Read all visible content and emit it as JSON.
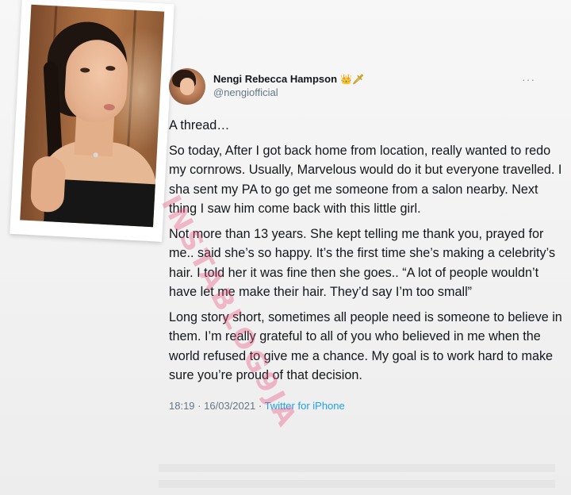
{
  "tweet": {
    "display_name": "Nengi Rebecca Hampson",
    "name_emojis": "👑🗡",
    "handle": "@nengiofficial",
    "more_icon": "more-icon",
    "paragraphs": [
      "A thread…",
      "So today, After I got back home from location, really wanted to redo my cornrows. Usually, Marvelous would do it but everyone travelled. I sha sent my PA to go get me someone from a salon nearby. Next thing I saw him come back with this little girl.",
      "Not more than 13 years. She kept telling me thank you, prayed for me.. said she’s so happy. It’s the first time she’s making a celebrity’s hair. I told her it was fine then she goes.. “A lot of people wouldn’t have let me make their hair. They’d say I’m too small”",
      "Long story short, sometimes all people need is someone to believe in them. I’m really grateful to all of you who believed in me when the world refused to give me a chance. My goal is to work hard to make sure you’re proud of that decision."
    ],
    "time": "18:19",
    "date": "16/03/2021",
    "separator": "·",
    "source": "Twitter for iPhone"
  },
  "watermark": "INSTABLOG9JA",
  "colors": {
    "text": "#14171a",
    "muted": "#657786",
    "link": "#1da1f2",
    "watermark": "#ec4878"
  }
}
